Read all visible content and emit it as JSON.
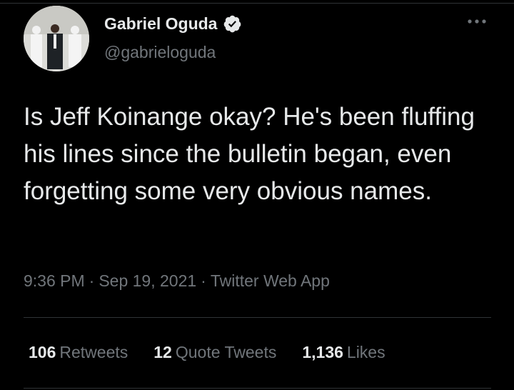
{
  "tweet": {
    "author": {
      "name": "Gabriel Oguda",
      "handle": "@gabrieloguda",
      "verified": true
    },
    "text": "Is Jeff Koinange okay? He's been fluffing his lines since the bulletin began, even forgetting some very obvious names.",
    "time": "9:36 PM",
    "date": "Sep 19, 2021",
    "source": "Twitter Web App",
    "meta_separator": "·",
    "stats": {
      "retweets": {
        "count": "106",
        "label": "Retweets"
      },
      "quote_tweets": {
        "count": "12",
        "label": "Quote Tweets"
      },
      "likes": {
        "count": "1,136",
        "label": "Likes"
      }
    }
  },
  "icons": {
    "verified": "verified-badge-icon",
    "more": "more-options-icon"
  },
  "colors": {
    "background": "#000000",
    "primary_text": "#e7e9ea",
    "secondary_text": "#71767b",
    "divider": "#2f3336"
  }
}
